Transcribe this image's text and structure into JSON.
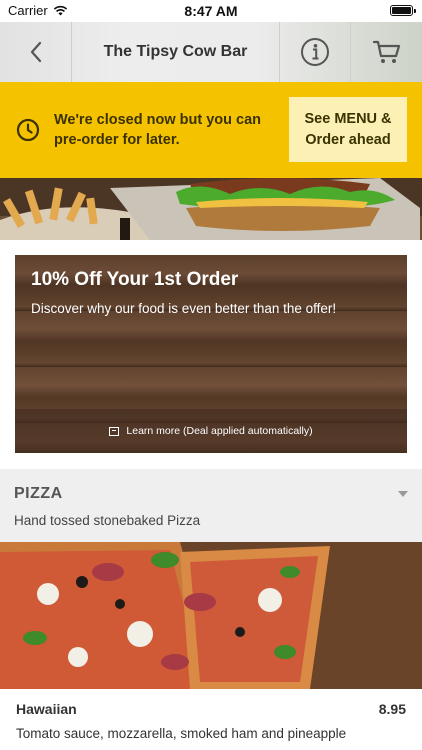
{
  "status_bar": {
    "carrier": "Carrier",
    "time": "8:47 AM"
  },
  "header": {
    "title": "The Tipsy Cow Bar"
  },
  "closed_banner": {
    "message": "We're closed now but you can pre-order for later.",
    "button_label": "See MENU &\nOrder ahead"
  },
  "promo": {
    "title": "10% Off Your 1st Order",
    "subtitle": "Discover why our food is even better than the offer!",
    "link_text": "Learn more (Deal applied automatically)"
  },
  "category": {
    "name": "PIZZA",
    "description": "Hand tossed stonebaked Pizza"
  },
  "menu_item": {
    "name": "Hawaiian",
    "price": "8.95",
    "description": "Tomato sauce, mozzarella, smoked ham and pineapple"
  },
  "colors": {
    "accent_yellow": "#f5c200",
    "button_cream": "#fcf0b4"
  }
}
